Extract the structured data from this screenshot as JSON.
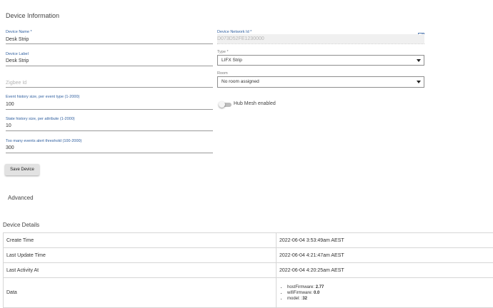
{
  "device_information": {
    "title": "Device Information",
    "device_name": {
      "label": "Device Name *",
      "value": "Desk Strip"
    },
    "device_label": {
      "label": "Device Label",
      "value": "Desk Strip"
    },
    "zigbee_id": {
      "placeholder": "Zigbee Id"
    },
    "event_history": {
      "label": "Event history size, per event type (1-2000)",
      "value": "100"
    },
    "state_history": {
      "label": "State history size, per attribute (1-2000)",
      "value": "10"
    },
    "too_many_events": {
      "label": "Too many events alert threshold (100-2000)",
      "value": "300"
    },
    "save_button": "Save Device",
    "network_id": {
      "label": "Device Network Id *",
      "value": "D073D52FE1230000"
    },
    "edit_icon": "edit-icon",
    "type": {
      "label": "Type *",
      "selected": "LIFX Strip"
    },
    "room": {
      "label": "Room",
      "selected": "No room assigned"
    },
    "hub_mesh": {
      "label": "Hub Mesh enabled",
      "enabled": false
    }
  },
  "advanced": {
    "label": "Advanced"
  },
  "device_details": {
    "title": "Device Details",
    "rows": [
      {
        "label": "Create Time",
        "value": "2022-06-04 3:53:49am AEST"
      },
      {
        "label": "Last Update Time",
        "value": "2022-06-04 4:21:47am AEST"
      },
      {
        "label": "Last Activity At",
        "value": "2022-06-04 4:20:25am AEST"
      }
    ],
    "data_row": {
      "label": "Data",
      "items": [
        {
          "key": "hostFirmware:",
          "value": "2.77"
        },
        {
          "key": "wifiFirmware:",
          "value": "0.0"
        },
        {
          "key": "model: :",
          "value": "32"
        }
      ]
    }
  },
  "colors": {
    "label_blue": "#2f5f9f",
    "border": "#d6d6d6",
    "button_bg": "#e2e2e2"
  }
}
